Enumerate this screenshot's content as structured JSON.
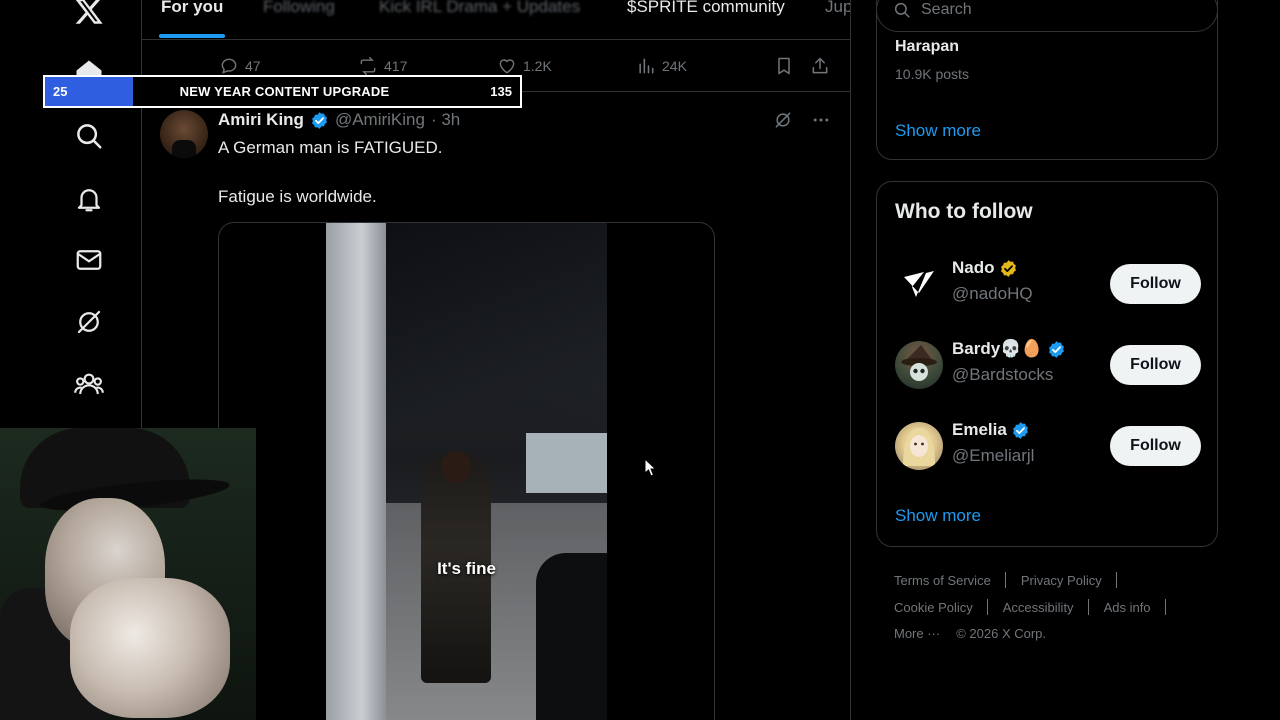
{
  "nav": {
    "icons": [
      "x-logo-icon",
      "home-icon",
      "search-icon",
      "notifications-bell-icon",
      "messages-envelope-icon",
      "grok-icon",
      "communities-icon"
    ]
  },
  "tabs": [
    {
      "label": "For you",
      "active": true
    },
    {
      "label": "Following",
      "active": false
    },
    {
      "label": "Kick IRL Drama + Updates",
      "active": false
    },
    {
      "label": "$SPRITE community",
      "active": false
    },
    {
      "label": "Jup",
      "active": false
    }
  ],
  "prev_post_actions": {
    "replies": "47",
    "reposts": "417",
    "likes": "1.2K",
    "views": "24K"
  },
  "post": {
    "author_name": "Amiri King",
    "author_handle": "@AmiriKing",
    "time": "· 3h",
    "text_line1": "A German man is FATIGUED.",
    "text_line2": "Fatigue is worldwide.",
    "video_caption": "It's fine"
  },
  "search": {
    "placeholder": "Search"
  },
  "trends": {
    "name": "Harapan",
    "count": "10.9K posts",
    "show_more": "Show more"
  },
  "who_to_follow": {
    "title": "Who to follow",
    "users": [
      {
        "name": "Nado",
        "handle": "@nadoHQ",
        "badge": "gold",
        "button": "Follow"
      },
      {
        "name": "Bardy💀🥚",
        "handle": "@Bardstocks",
        "badge": "blue",
        "button": "Follow"
      },
      {
        "name": "Emelia",
        "handle": "@Emeliarjl",
        "badge": "blue",
        "button": "Follow"
      }
    ],
    "show_more": "Show more"
  },
  "footer": {
    "links_row1": [
      "Terms of Service",
      "Privacy Policy"
    ],
    "links_row2": [
      "Cookie Policy",
      "Accessibility",
      "Ads info"
    ],
    "more": "More ···",
    "copyright": "© 2026 X Corp."
  },
  "overlay": {
    "left_value": "25",
    "title": "NEW YEAR CONTENT UPGRADE",
    "right_value": "135",
    "progress": 0.185
  },
  "colors": {
    "accent": "#1d9bf0",
    "background": "#000000",
    "border": "#2f3336",
    "muted": "#71767b",
    "overlay_fill": "#2f5fe0"
  }
}
